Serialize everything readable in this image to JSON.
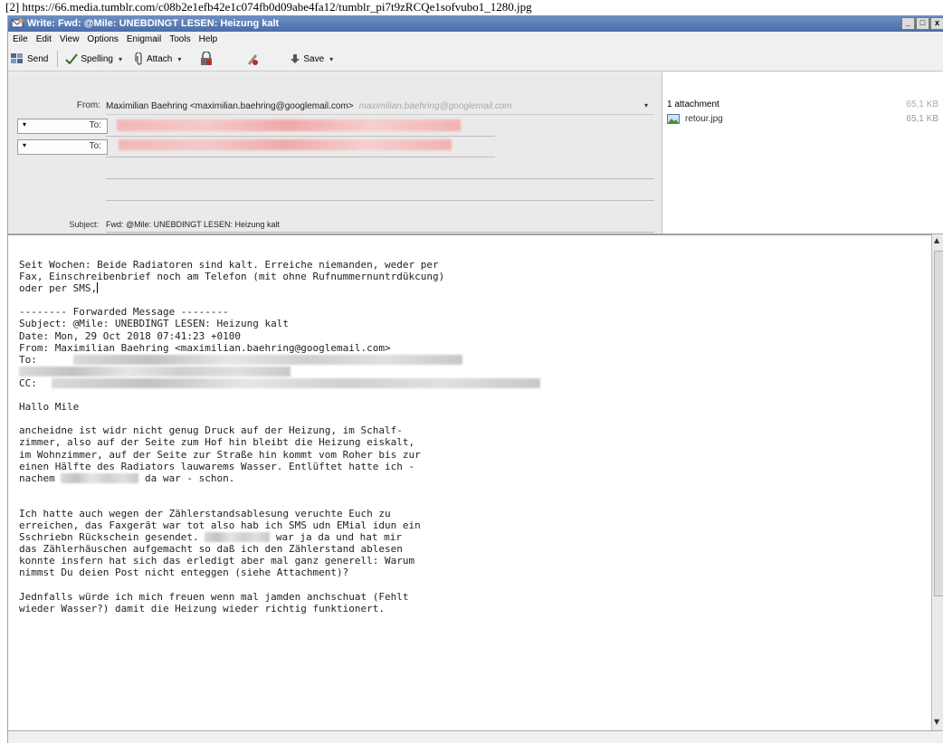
{
  "source_url": "[2] https://66.media.tumblr.com/c08b2e1efb42e1c074fb0d09abe4fa12/tumblr_pi7t9zRCQe1sofvubo1_1280.jpg",
  "window": {
    "title": "Write: Fwd: @Mile: UNEBDINGT LESEN: Heizung kalt",
    "controls": [
      "_",
      "□",
      "x"
    ]
  },
  "menu": [
    "Eile",
    "Edit",
    "View",
    "Options",
    "Enigmail",
    "Tools",
    "Help"
  ],
  "toolbar": {
    "send": "Send",
    "spelling": "Spelling",
    "attach": "Attach",
    "save": "Save",
    "caret": "▾"
  },
  "header": {
    "from_label": "From:",
    "from_value": "Maximilian Baehring <maximilian.baehring@googlemail.com>",
    "from_ghost": "maximilian.baehring@googlemail.com",
    "to_label": "To:",
    "to2_label": "To:",
    "subject_label": "Subject:",
    "subject_value": "Fwd: @Mile: UNEBDINGT LESEN: Heizung kalt"
  },
  "attachments": {
    "header": "1 attachment",
    "total_size": "65,1 KB",
    "items": [
      {
        "name": "retour.jpg",
        "size": "65,1 KB"
      }
    ]
  },
  "body": {
    "intro": "Seit Wochen: Beide Radiatoren sind kalt. Erreiche niemanden, weder per\nFax, Einschreibenbrief noch am Telefon (mit ohne Rufnummernuntrdükcung)\noder per SMS,",
    "fwd_header": "-------- Forwarded Message --------",
    "fwd_subject": "Subject: @Mile: UNEBDINGT LESEN: Heizung kalt",
    "fwd_date": "Date: Mon, 29 Oct 2018 07:41:23 +0100",
    "fwd_from": "From: Maximilian Baehring <maximilian.baehring@googlemail.com>",
    "fwd_to_label": "To:",
    "fwd_cc_label": "CC:",
    "greeting": "Hallo Mile",
    "para1_a": "ancheidne ist widr nicht genug Druck auf der Heizung, im Schalf-\nzimmer, also auf der Seite zum Hof hin bleibt die Heizung eiskalt,\nim Wohnzimmer, auf der Seite zur Straße hin kommt vom Roher bis zur\neinen Hälfte des Radiators lauwarems Wasser. Entlüftet hatte ich -\nnachem ",
    "para1_b": " da war - schon.",
    "para2_a": "Ich hatte auch wegen der Zählerstandsablesung veruchte Euch zu\nerreichen, das Faxgerät war tot also hab ich SMS udn EMial idun ein\nSschriebn Rückschein gesendet. ",
    "para2_b": " war ja da und hat mir\ndas Zählerhäuschen aufgemacht so daß ich den Zählerstand ablesen\nkonnte insfern hat sich das erledigt aber mal ganz generell: Warum\nnimmst Du deien Post nicht enteggen (siehe Attachment)?",
    "para3": "Jednfalls würde ich mich freuen wenn mal jamden anchschuat (Fehlt\nwieder Wasser?) damit die Heizung wieder richtig funktionert."
  },
  "colors": {
    "titlebar": "#4a6ea9",
    "redaction_pink": "#f2b7b7",
    "redaction_gray": "#cfcfcf"
  }
}
